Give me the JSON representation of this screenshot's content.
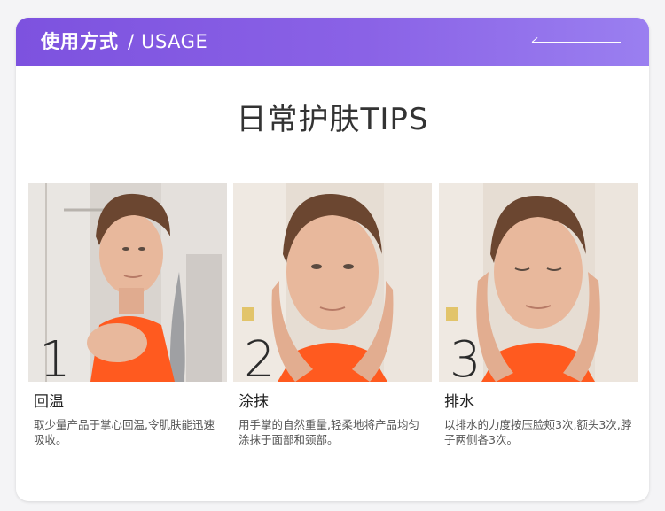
{
  "header": {
    "title_zh": "使用方式",
    "separator": "/",
    "title_en": "USAGE",
    "gradient_start": "#7d52df",
    "gradient_end": "#9a7ff0"
  },
  "main_title": "日常护肤TIPS",
  "steps": [
    {
      "number": "1",
      "title": "回温",
      "description": "取少量产品于掌心回温,令肌肤能迅速吸收。"
    },
    {
      "number": "2",
      "title": "涂抹",
      "description": "用手掌的自然重量,轻柔地将产品均匀涂抹于面部和颈部。"
    },
    {
      "number": "3",
      "title": "排水",
      "description": "以排水的力度按压脸颊3次,额头3次,脖子两侧各3次。"
    }
  ],
  "colors": {
    "top_color": "#ff5a1f",
    "skin": "#e8b89c",
    "hair": "#6b4630"
  }
}
